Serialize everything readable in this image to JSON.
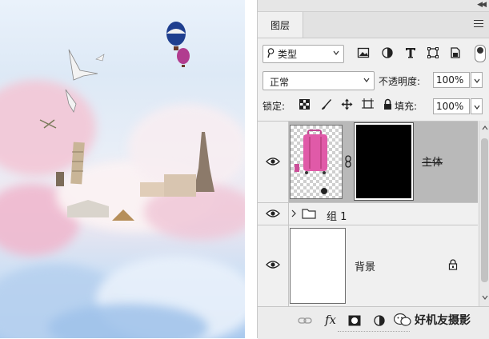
{
  "panel": {
    "tab_label": "图层",
    "filter": {
      "label": "类型"
    },
    "blend_mode": "正常",
    "opacity_label": "不透明度:",
    "opacity_value": "100%",
    "lock_label": "锁定:",
    "fill_label": "填充:",
    "fill_value": "100%"
  },
  "layers": [
    {
      "name": "主体",
      "visible": true,
      "selected": true,
      "type": "masked-image"
    },
    {
      "name": "组 1",
      "visible": true,
      "selected": false,
      "type": "group"
    },
    {
      "name": "背景",
      "visible": true,
      "selected": false,
      "type": "background",
      "locked": true
    }
  ],
  "bottom_bar": {
    "icons": [
      "link-icon",
      "fx-icon",
      "mask-icon",
      "adjustment-icon"
    ],
    "fx_label": "fx"
  },
  "watermark": {
    "text": "好机友摄影"
  },
  "colors": {
    "panel_bg": "#f0f0f0",
    "selected_row": "#b9b9b9",
    "mask_fill": "#000000",
    "suitcase": "#e05aa8"
  }
}
